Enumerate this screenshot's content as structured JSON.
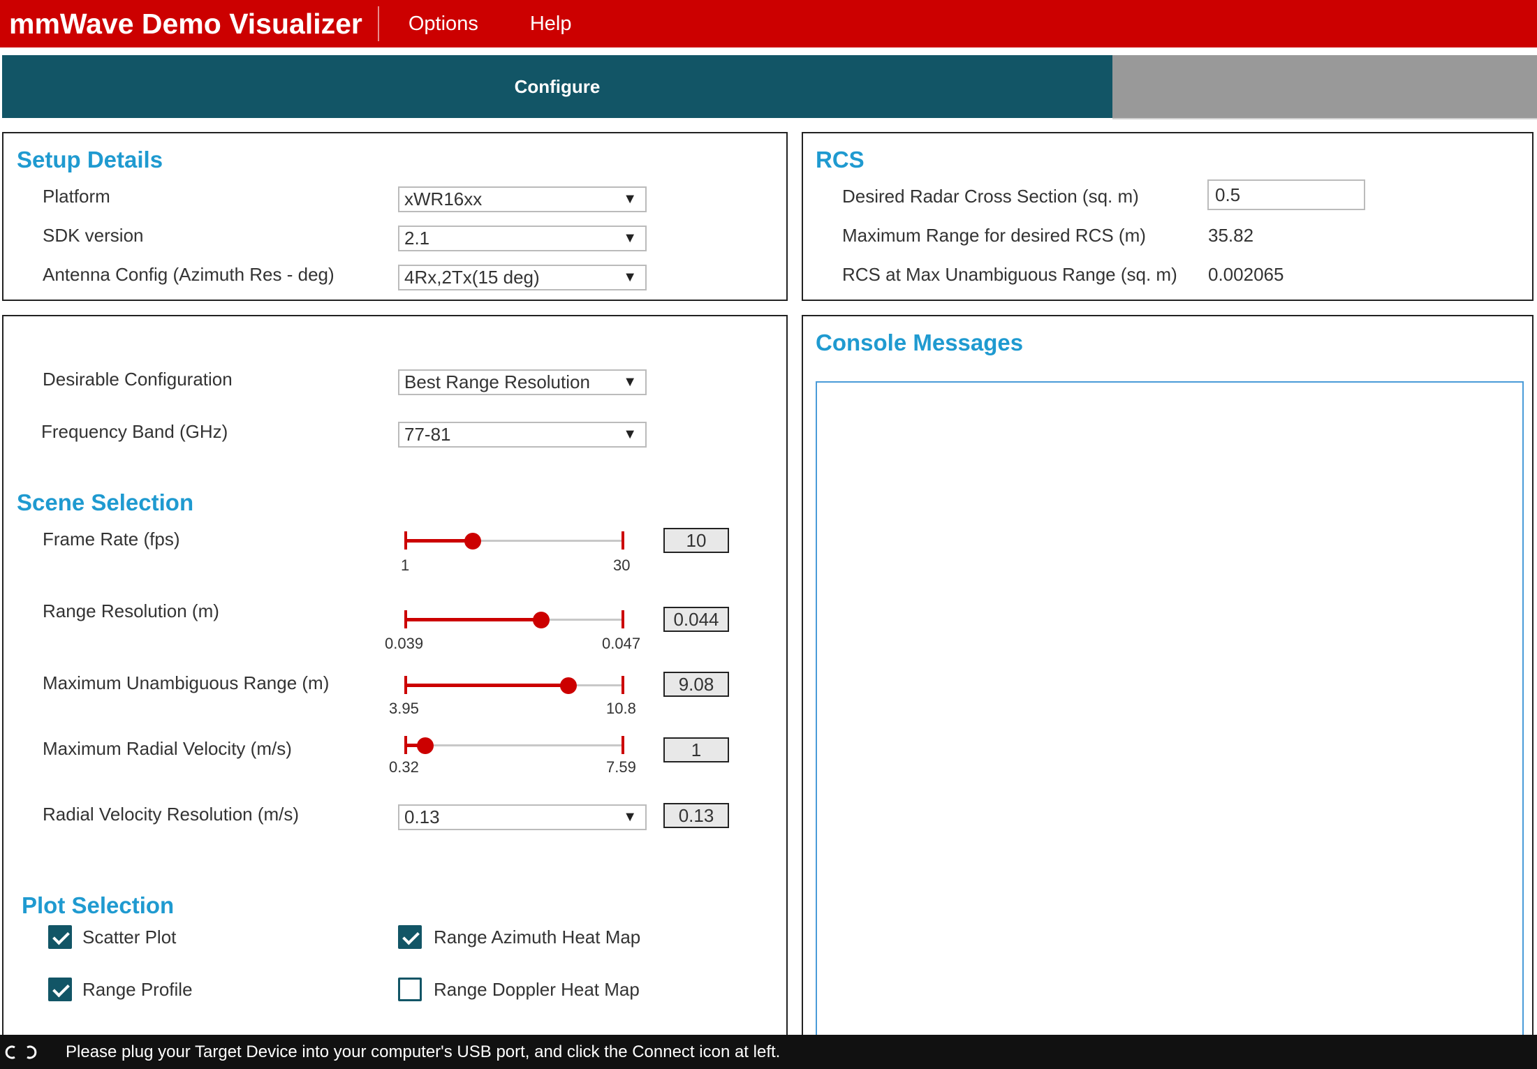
{
  "app": {
    "title": "mmWave Demo Visualizer"
  },
  "menu": {
    "items": [
      "Options",
      "Help"
    ]
  },
  "tabs": {
    "active": "Configure"
  },
  "setup": {
    "heading": "Setup Details",
    "platform": {
      "label": "Platform",
      "value": "xWR16xx"
    },
    "sdk": {
      "label": "SDK version",
      "value": "2.1"
    },
    "antenna": {
      "label": "Antenna Config (Azimuth Res - deg)",
      "value": "4Rx,2Tx(15 deg)"
    }
  },
  "rcs": {
    "heading": "RCS",
    "desired": {
      "label": "Desired Radar Cross Section (sq. m)",
      "value": "0.5"
    },
    "max_range": {
      "label": "Maximum Range for desired RCS (m)",
      "value": "35.82"
    },
    "rcs_max": {
      "label": "RCS at Max Unambiguous Range (sq. m)",
      "value": "0.002065"
    }
  },
  "config": {
    "desirable": {
      "label": "Desirable Configuration",
      "value": "Best Range Resolution"
    },
    "band": {
      "label": "Frequency Band (GHz)",
      "value": "77-81"
    }
  },
  "scene": {
    "heading": "Scene Selection",
    "frame_rate": {
      "label": "Frame Rate (fps)",
      "min": "1",
      "max": "30",
      "value": "10",
      "fraction": 0.31
    },
    "range_res": {
      "label": "Range Resolution (m)",
      "min": "0.039",
      "max": "0.047",
      "value": "0.044",
      "fraction": 0.625
    },
    "max_range": {
      "label": "Maximum Unambiguous Range (m)",
      "min": "3.95",
      "max": "10.8",
      "value": "9.08",
      "fraction": 0.75
    },
    "max_vel": {
      "label": "Maximum Radial Velocity (m/s)",
      "min": "0.32",
      "max": "7.59",
      "value": "1",
      "fraction": 0.09
    },
    "vel_res": {
      "label": "Radial Velocity Resolution (m/s)",
      "value": "0.13",
      "box": "0.13"
    }
  },
  "plots": {
    "heading": "Plot Selection",
    "scatter": {
      "label": "Scatter Plot",
      "checked": true
    },
    "range_azimuth": {
      "label": "Range Azimuth Heat Map",
      "checked": true
    },
    "range_profile": {
      "label": "Range Profile",
      "checked": true
    },
    "range_doppler": {
      "label": "Range Doppler Heat Map",
      "checked": false
    }
  },
  "console": {
    "heading": "Console Messages"
  },
  "status": {
    "message": "Please plug your Target Device into your computer's USB port, and click the Connect icon at left."
  },
  "colors": {
    "brand_red": "#cc0000",
    "tab_teal": "#125566",
    "heading_blue": "#1f9ad0"
  }
}
